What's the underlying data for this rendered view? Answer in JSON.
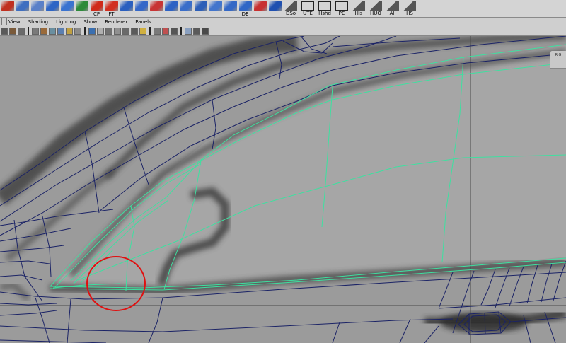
{
  "shelf": {
    "items": [
      {
        "name": "nurbs-curve",
        "label": "",
        "color": "#c03020",
        "kind": "icon"
      },
      {
        "name": "surface",
        "label": "",
        "color": "#3f6fc0",
        "kind": "icon"
      },
      {
        "name": "cv-tool",
        "label": "",
        "color": "#5a80c8",
        "kind": "icon"
      },
      {
        "name": "patch",
        "label": "",
        "color": "#2e65c5",
        "kind": "icon"
      },
      {
        "name": "rebuild",
        "label": "",
        "color": "#3a73d0",
        "kind": "icon"
      },
      {
        "name": "sphere",
        "label": "",
        "color": "#2e8a3a",
        "kind": "icon"
      },
      {
        "name": "cp",
        "label": "CP",
        "color": "#d02a1a",
        "kind": "icon"
      },
      {
        "name": "ft",
        "label": "FT",
        "color": "#d23020",
        "kind": "icon"
      },
      {
        "name": "loft",
        "label": "",
        "color": "#2a5fbf",
        "kind": "icon"
      },
      {
        "name": "birail",
        "label": "",
        "color": "#3568c8",
        "kind": "icon"
      },
      {
        "name": "boundary",
        "label": "",
        "color": "#c83535",
        "kind": "icon"
      },
      {
        "name": "square",
        "label": "",
        "color": "#2d62c4",
        "kind": "icon"
      },
      {
        "name": "grid-surface",
        "label": "",
        "color": "#3a6ec9",
        "kind": "icon"
      },
      {
        "name": "extrude",
        "label": "",
        "color": "#2d5fb8",
        "kind": "icon"
      },
      {
        "name": "planar",
        "label": "",
        "color": "#4275cc",
        "kind": "icon"
      },
      {
        "name": "revolve",
        "label": "",
        "color": "#3468c6",
        "kind": "icon"
      },
      {
        "name": "de",
        "label": "DE",
        "color": "#2f66c6",
        "kind": "icon"
      },
      {
        "name": "attach",
        "label": "",
        "color": "#c83030",
        "kind": "icon"
      },
      {
        "name": "align",
        "label": "",
        "color": "#1f50b0",
        "kind": "icon"
      },
      {
        "name": "dso",
        "label": "DSo",
        "color": "",
        "kind": "ramp"
      },
      {
        "name": "ute",
        "label": "UTE",
        "color": "",
        "kind": "outline"
      },
      {
        "name": "hshd",
        "label": "Hshd",
        "color": "",
        "kind": "outline"
      },
      {
        "name": "pe",
        "label": "PE",
        "color": "",
        "kind": "outline"
      },
      {
        "name": "his",
        "label": "His",
        "color": "",
        "kind": "ramp"
      },
      {
        "name": "huo",
        "label": "HUO",
        "color": "",
        "kind": "ramp"
      },
      {
        "name": "all",
        "label": "All",
        "color": "",
        "kind": "ramp"
      },
      {
        "name": "hs",
        "label": "HS",
        "color": "",
        "kind": "ramp"
      }
    ]
  },
  "menubar": {
    "items": [
      "View",
      "Shading",
      "Lighting",
      "Show",
      "Renderer",
      "Panels"
    ]
  },
  "toolrow": {
    "tools": [
      {
        "name": "select-camera",
        "color": "#5a5a5a"
      },
      {
        "name": "lock-camera",
        "color": "#7a5a3a"
      },
      {
        "name": "bookmarks",
        "color": "#6a6a6a"
      },
      {
        "name": "wireframe",
        "color": "#7a7a7a"
      },
      {
        "name": "smooth-shade",
        "color": "#9a6a3a"
      },
      {
        "name": "flat-shade",
        "color": "#6a8fa0"
      },
      {
        "name": "textured",
        "color": "#5b7fb0"
      },
      {
        "name": "use-lights",
        "color": "#c0a040"
      },
      {
        "name": "shadows",
        "color": "#8a8a8a"
      },
      {
        "name": "isolate",
        "color": "#3a6fb0"
      },
      {
        "name": "xray",
        "color": "#b0b0b0"
      },
      {
        "name": "resolution-gate",
        "color": "#707070"
      },
      {
        "name": "film-gate",
        "color": "#909090"
      },
      {
        "name": "field-chart",
        "color": "#6a6a6a"
      },
      {
        "name": "safe-action",
        "color": "#5a5a5a"
      },
      {
        "name": "grid-toggle",
        "color": "#d0b040"
      },
      {
        "name": "hud",
        "color": "#7a7a7a"
      },
      {
        "name": "camera-attributes",
        "color": "#c05050"
      },
      {
        "name": "frame-all",
        "color": "#555555"
      },
      {
        "name": "image-plane",
        "color": "#8aa0c0"
      },
      {
        "name": "two-pane",
        "color": "#5a5a5a"
      },
      {
        "name": "four-pane",
        "color": "#4a4a4a"
      }
    ]
  },
  "viewport": {
    "camera_label": "RIG",
    "colors": {
      "background": "#9a9a9a",
      "panel_light": "#a8a8a8",
      "wire_dark": "#1a2268",
      "wire_selected": "#3ee0a0",
      "annotation": "#e01010",
      "axis": "#444444"
    }
  }
}
